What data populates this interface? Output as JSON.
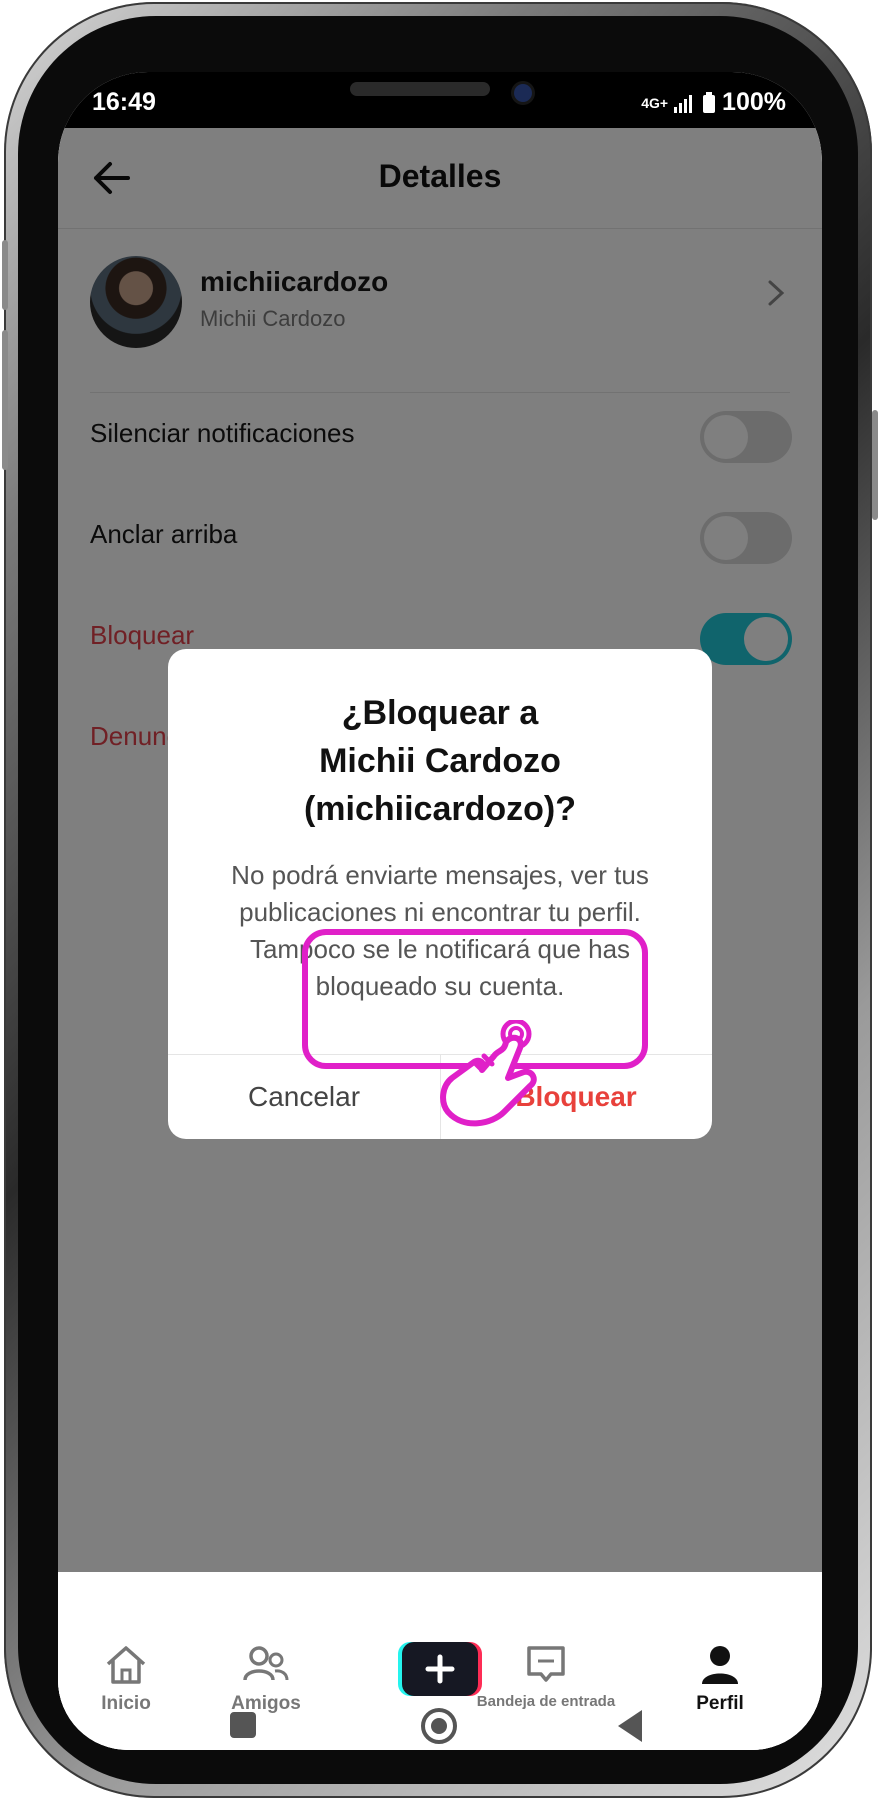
{
  "status_bar": {
    "time": "16:49",
    "network": "4G+",
    "battery": "100%"
  },
  "header": {
    "title": "Detalles"
  },
  "profile": {
    "username": "michiicardozo",
    "display_name": "Michii Cardozo"
  },
  "settings": [
    {
      "label": "Silenciar notificaciones",
      "enabled": false
    },
    {
      "label": "Anclar arriba",
      "enabled": false
    },
    {
      "label": "Bloquear",
      "enabled": true
    },
    {
      "label": "Denunciar"
    }
  ],
  "dialog": {
    "title_line1": "¿Bloquear a",
    "title_line2": "Michii Cardozo",
    "title_line3": "(michiicardozo)?",
    "body": "No podrá enviarte mensajes, ver tus publicaciones ni encontrar tu perfil. Tampoco se le notificará que has bloqueado su cuenta.",
    "cancel_label": "Cancelar",
    "confirm_label": "Bloquear"
  },
  "bottom_nav": [
    {
      "label": "Inicio",
      "icon": "home-icon"
    },
    {
      "label": "Amigos",
      "icon": "friends-icon"
    },
    {
      "label": "",
      "icon": "plus-icon"
    },
    {
      "label": "Bandeja de entrada",
      "icon": "inbox-icon"
    },
    {
      "label": "Perfil",
      "icon": "profile-icon",
      "active": true
    }
  ],
  "colors": {
    "accent_red": "#e8413b",
    "toggle_on": "#20c8d8",
    "highlight": "#e020c8"
  }
}
